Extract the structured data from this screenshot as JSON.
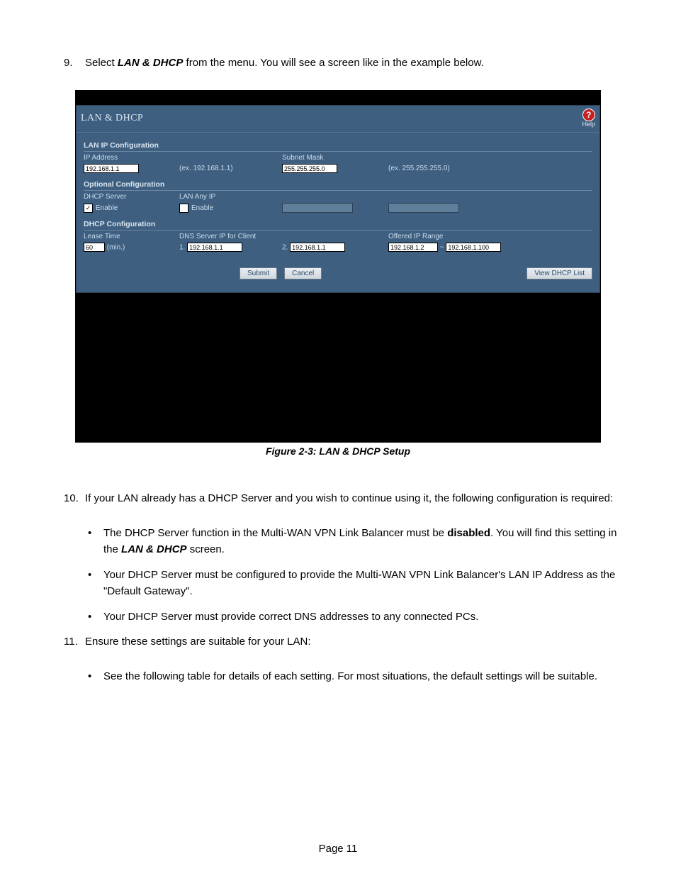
{
  "step9": {
    "num": "9.",
    "pre": "Select ",
    "bold": "LAN & DHCP",
    "post": " from the menu. You will see a screen like in the example below."
  },
  "ss": {
    "title": "LAN & DHCP",
    "help": "Help",
    "sec_lan": "LAN IP Configuration",
    "ip_label": "IP Address",
    "ip_val": "192.168.1.1",
    "ip_hint": "(ex. 192.168.1.1)",
    "subnet_label": "Subnet Mask",
    "subnet_val": "255.255.255.0",
    "subnet_hint": "(ex. 255.255.255.0)",
    "sec_opt": "Optional Configuration",
    "dhcp_server_label": "DHCP Server",
    "lan_any_label": "LAN Any IP",
    "enable": "Enable",
    "sec_dhcp": "DHCP Configuration",
    "lease_label": "Lease Time",
    "lease_val": "60",
    "lease_unit": "(min.)",
    "dns_label": "DNS Server IP for Client",
    "dns1_pre": "1.",
    "dns1_val": "192.168.1.1",
    "dns2_pre": "2.",
    "dns2_val": "192.168.1.1",
    "range_label": "Offered IP Range",
    "range_from": "192.168.1.2",
    "range_sep": "~",
    "range_to": "192.168.1.100",
    "btn_submit": "Submit",
    "btn_cancel": "Cancel",
    "btn_view": "View DHCP List"
  },
  "caption": "Figure 2-3: LAN & DHCP Setup",
  "step10": {
    "num": "10.",
    "text": "If your LAN already has a DHCP Server and you wish to continue using it, the following configuration is required:",
    "b1_pre": "The DHCP Server function in the Multi-WAN VPN Link Balancer must be ",
    "b1_bold": "disabled",
    "b1_mid": ". You will find this setting in the ",
    "b1_bold2": "LAN & DHCP",
    "b1_post": " screen.",
    "b2": "Your DHCP Server must be configured to provide the Multi-WAN VPN Link Balancer's LAN IP Address as the \"Default Gateway\".",
    "b3": "Your DHCP Server must provide correct DNS addresses to any connected PCs."
  },
  "step11": {
    "num": "11.",
    "text": "Ensure these settings are suitable for your LAN:",
    "b1": "See the following table for details of each setting.  For most situations, the default settings will be suitable."
  },
  "page_num": "Page 11"
}
